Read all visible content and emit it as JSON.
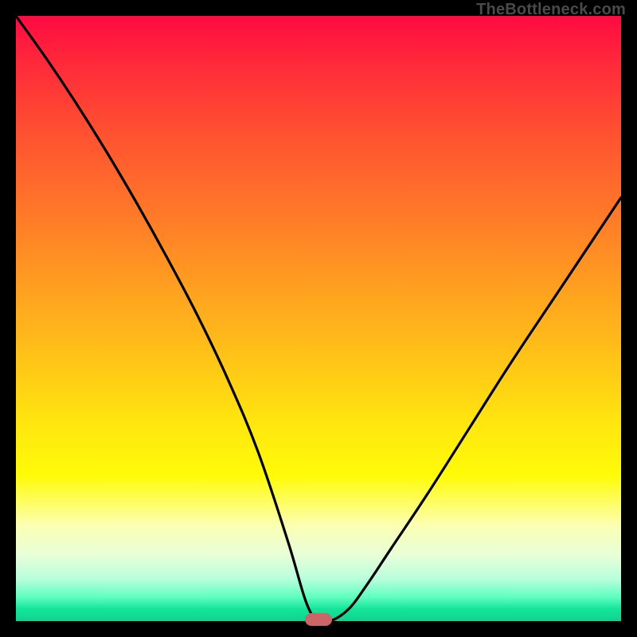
{
  "watermark": "TheBottleneck.com",
  "colors": {
    "background": "#000000",
    "curve": "#000000",
    "marker": "#cc6666",
    "gradient_top": "#ff0b41",
    "gradient_bottom": "#0fd38f"
  },
  "chart_data": {
    "type": "line",
    "title": "",
    "xlabel": "",
    "ylabel": "",
    "xlim": [
      0,
      100
    ],
    "ylim": [
      0,
      100
    ],
    "grid": false,
    "series": [
      {
        "name": "bottleneck-curve",
        "x": [
          0,
          5,
          10,
          15,
          20,
          25,
          30,
          35,
          40,
          45,
          48,
          50,
          52,
          55,
          58,
          62,
          68,
          75,
          82,
          90,
          100
        ],
        "values": [
          100,
          93,
          85.5,
          77.5,
          69,
          60,
          50.5,
          40,
          28,
          13,
          3,
          0,
          0,
          2,
          6,
          12,
          21,
          32,
          43,
          55,
          70
        ]
      }
    ],
    "annotations": [
      {
        "name": "min-marker",
        "x": 50,
        "y": 0,
        "shape": "pill"
      }
    ]
  }
}
